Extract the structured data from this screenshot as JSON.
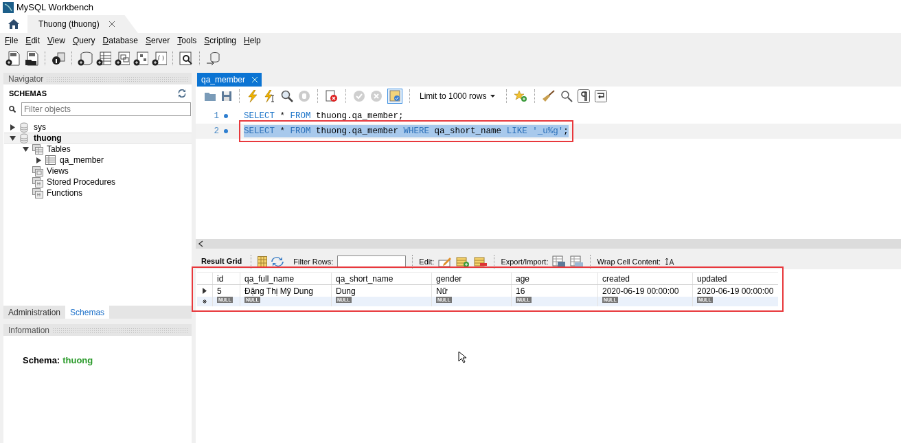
{
  "window": {
    "title": "MySQL Workbench"
  },
  "app_tabs": [
    {
      "label": "Thuong (thuong)"
    }
  ],
  "menu": [
    "File",
    "Edit",
    "View",
    "Query",
    "Database",
    "Server",
    "Tools",
    "Scripting",
    "Help"
  ],
  "navigator": {
    "title": "Navigator",
    "section": "SCHEMAS",
    "filter": {
      "placeholder": "Filter objects"
    },
    "tree": [
      {
        "label": "sys",
        "kind": "schema",
        "expanded": false,
        "selected": false,
        "default": false
      },
      {
        "label": "thuong",
        "kind": "schema",
        "expanded": true,
        "selected": true,
        "default": true,
        "children": [
          {
            "label": "Tables",
            "kind": "tables",
            "expanded": true,
            "children": [
              {
                "label": "qa_member",
                "kind": "table",
                "expanded": false
              }
            ]
          },
          {
            "label": "Views",
            "kind": "views"
          },
          {
            "label": "Stored Procedures",
            "kind": "routines"
          },
          {
            "label": "Functions",
            "kind": "routines"
          }
        ]
      }
    ]
  },
  "side_tabs": [
    {
      "label": "Administration",
      "selected": false
    },
    {
      "label": "Schemas",
      "selected": true
    }
  ],
  "information": {
    "title": "Information",
    "label": "Schema:",
    "value": "thuong"
  },
  "editor_tabs": [
    {
      "label": "qa_member",
      "selected": true
    }
  ],
  "editor_toolbar": {
    "limit": "Limit to 1000 rows",
    "autocommit": true,
    "commit_enabled": false
  },
  "editor_lines": [
    {
      "number": "1",
      "selected": false,
      "annotated": false,
      "tokens": [
        {
          "kind": "keyword",
          "text": "SELECT"
        },
        {
          "kind": "plain",
          "text": " * "
        },
        {
          "kind": "keyword",
          "text": "FROM"
        },
        {
          "kind": "plain",
          "text": " thuong.qa_member;"
        }
      ]
    },
    {
      "number": "2",
      "selected": true,
      "annotated": true,
      "tokens": [
        {
          "kind": "keyword",
          "text": "SELECT"
        },
        {
          "kind": "plain",
          "text": " * "
        },
        {
          "kind": "keyword",
          "text": "FROM"
        },
        {
          "kind": "plain",
          "text": " thuong.qa_member "
        },
        {
          "kind": "keyword",
          "text": "WHERE"
        },
        {
          "kind": "plain",
          "text": " qa_short_name "
        },
        {
          "kind": "keyword",
          "text": "LIKE"
        },
        {
          "kind": "string",
          "text": " '_u%g'"
        },
        {
          "kind": "plain",
          "text": ";"
        }
      ]
    }
  ],
  "result_toolbar": {
    "title": "Result Grid",
    "filter_label": "Filter Rows:",
    "edit_label": "Edit:",
    "export_label": "Export/Import:",
    "wrap_label": "Wrap Cell Content:"
  },
  "results": {
    "annotated": true,
    "columns": [
      "id",
      "qa_full_name",
      "qa_short_name",
      "gender",
      "age",
      "created",
      "updated"
    ],
    "rows": [
      {
        "current": true,
        "cells": [
          "5",
          "Đặng Thị Mỹ Dung",
          "Dung",
          "Nữ",
          "16",
          "2020-06-19 00:00:00",
          "2020-06-19 00:00:00"
        ]
      }
    ],
    "new_row": [
      "NULL",
      "NULL",
      "NULL",
      "NULL",
      "NULL",
      "NULL",
      "NULL"
    ]
  }
}
